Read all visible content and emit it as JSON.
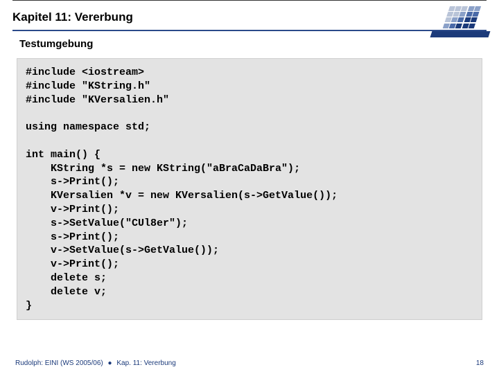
{
  "header": {
    "chapter": "Kapitel 11: Vererbung",
    "subtitle": "Testumgebung"
  },
  "code": "#include <iostream>\n#include \"KString.h\"\n#include \"KVersalien.h\"\n\nusing namespace std;\n\nint main() {\n    KString *s = new KString(\"aBraCaDaBra\");\n    s->Print();\n    KVersalien *v = new KVersalien(s->GetValue());\n    v->Print();\n    s->SetValue(\"CUl8er\");\n    s->Print();\n    v->SetValue(s->GetValue());\n    v->Print();\n    delete s;\n    delete v;\n}",
  "footer": {
    "left_course": "Rudolph: EINI (WS 2005/06)",
    "left_chapter": "Kap. 11: Vererbung",
    "page": "18"
  }
}
